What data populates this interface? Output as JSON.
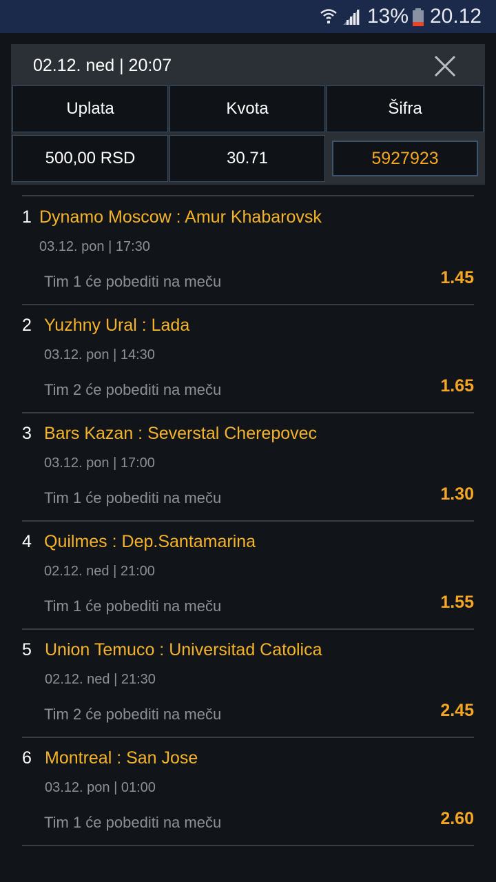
{
  "status_bar": {
    "battery_percent": "13%",
    "time": "20.12"
  },
  "ticket": {
    "datetime": "02.12. ned | 20:07",
    "headers": {
      "stake": "Uplata",
      "odds": "Kvota",
      "code": "Šifra"
    },
    "values": {
      "stake": "500,00 RSD",
      "odds": "30.71",
      "code": "5927923"
    }
  },
  "bets": [
    {
      "num": "1",
      "match": "Dynamo Moscow : Amur Khabarovsk",
      "date": "03.12. pon | 17:30",
      "pick": "Tim 1 će pobediti na meču",
      "odd": "1.45"
    },
    {
      "num": "2",
      "match": "Yuzhny Ural : Lada",
      "date": "03.12. pon | 14:30",
      "pick": "Tim 2 će pobediti na meču",
      "odd": "1.65"
    },
    {
      "num": "3",
      "match": "Bars Kazan : Severstal Cherepovec",
      "date": "03.12. pon | 17:00",
      "pick": "Tim 1 će pobediti na meču",
      "odd": "1.30"
    },
    {
      "num": "4",
      "match": "Quilmes : Dep.Santamarina",
      "date": "02.12. ned | 21:00",
      "pick": "Tim 1 će pobediti na meču",
      "odd": "1.55"
    },
    {
      "num": "5",
      "match": "Union Temuco : Universitad Catolica",
      "date": "02.12. ned | 21:30",
      "pick": "Tim 2 će pobediti na meču",
      "odd": "2.45"
    },
    {
      "num": "6",
      "match": "Montreal : San Jose",
      "date": "03.12. pon | 01:00",
      "pick": "Tim 1 će pobediti na meču",
      "odd": "2.60"
    }
  ],
  "colors": {
    "accent": "#f5a623",
    "background": "#111418",
    "status_bar": "#1b2a4a"
  }
}
